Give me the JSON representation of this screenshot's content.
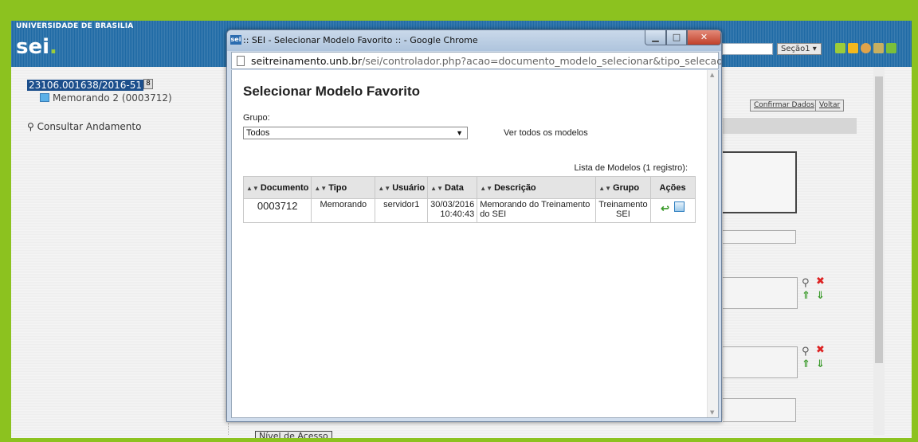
{
  "background_app": {
    "university": "UNIVERSIDADE DE BRASILIA",
    "logo": "sei",
    "logo_dot": ".",
    "section_select": "Seção1",
    "process_number": "23106.001638/2016-51",
    "process_badge": "8",
    "document_node": "Memorando 2 (0003712)",
    "consult_link": "Consultar Andamento",
    "confirm_button": "Confirmar Dados",
    "back_button": "Voltar",
    "access_level": "Nível de Acesso"
  },
  "window": {
    "icon_text": "sei",
    "title": ":: SEI - Selecionar Modelo Favorito :: - Google Chrome",
    "url_host": "seitreinamento.unb.br",
    "url_path": "/sei/controlador.php?acao=documento_modelo_selecionar&tipo_selecao"
  },
  "page": {
    "title": "Selecionar Modelo Favorito",
    "grupo_label": "Grupo:",
    "grupo_value": "Todos",
    "ver_todos": "Ver todos os modelos",
    "caption": "Lista de Modelos (1 registro):",
    "columns": [
      "Documento",
      "Tipo",
      "Usuário",
      "Data",
      "Descrição",
      "Grupo",
      "Ações"
    ],
    "rows": [
      {
        "documento": "0003712",
        "tipo": "Memorando",
        "usuario": "servidor1",
        "data_date": "30/03/2016",
        "data_time": "10:40:43",
        "descricao": "Memorando do Treinamento do SEI",
        "grupo": "Treinamento SEI"
      }
    ]
  }
}
